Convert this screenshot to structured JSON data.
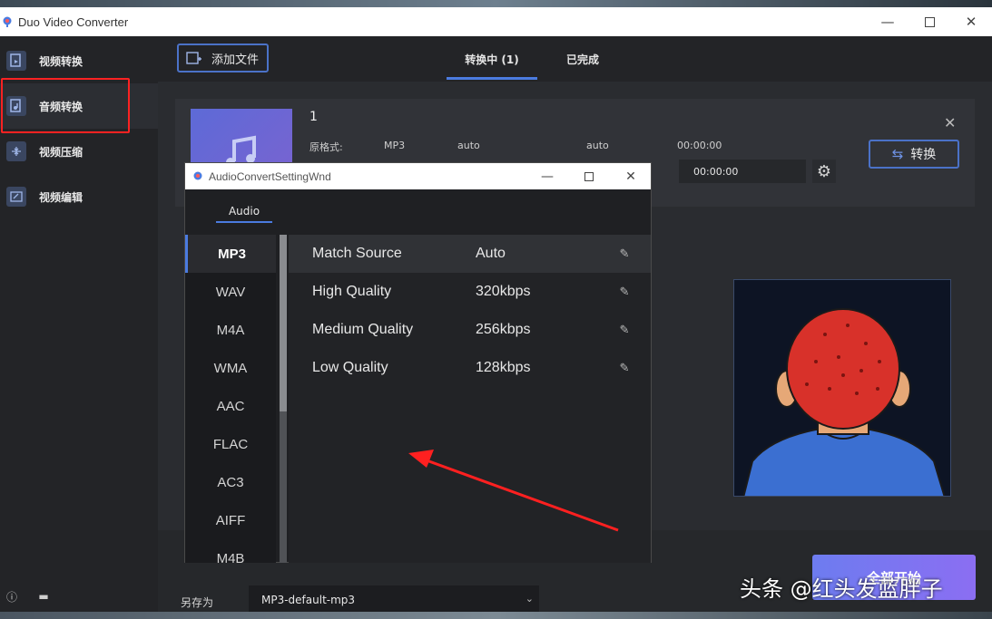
{
  "app": {
    "title": "Duo Video Converter"
  },
  "sidebar": {
    "items": [
      {
        "label": "视频转换",
        "icon": "video-convert-icon"
      },
      {
        "label": "音频转换",
        "icon": "audio-convert-icon"
      },
      {
        "label": "视频压缩",
        "icon": "video-compress-icon"
      },
      {
        "label": "视频编辑",
        "icon": "video-edit-icon"
      }
    ],
    "active_index": 1
  },
  "header": {
    "add_file_label": "添加文件",
    "tabs": [
      {
        "label": "转换中 (1)",
        "active": true
      },
      {
        "label": "已完成",
        "active": false
      }
    ]
  },
  "file": {
    "name": "1",
    "source_label": "原格式:",
    "source_format": "MP3",
    "bitrate": "auto",
    "sample_rate": "auto",
    "duration": "00:00:00",
    "target_duration": "00:00:00",
    "convert_label": "转换"
  },
  "dialog": {
    "title": "AudioConvertSettingWnd",
    "tab": "Audio",
    "formats": [
      "MP3",
      "WAV",
      "M4A",
      "WMA",
      "AAC",
      "FLAC",
      "AC3",
      "AIFF",
      "M4B"
    ],
    "selected_format": "MP3",
    "qualities": [
      {
        "name": "Match Source",
        "value": "Auto",
        "selected": true
      },
      {
        "name": "High Quality",
        "value": "320kbps",
        "selected": false
      },
      {
        "name": "Medium Quality",
        "value": "256kbps",
        "selected": false
      },
      {
        "name": "Low Quality",
        "value": "128kbps",
        "selected": false
      }
    ]
  },
  "footer": {
    "save_as_label": "另存为",
    "save_as_value": "MP3-default-mp3",
    "start_all_label": "全部开始"
  },
  "watermark": "头条 @红头发蓝胖子",
  "colors": {
    "accent": "#4b7be0",
    "annotation_red": "#ff2222",
    "start_gradient": "#7b76f1"
  }
}
